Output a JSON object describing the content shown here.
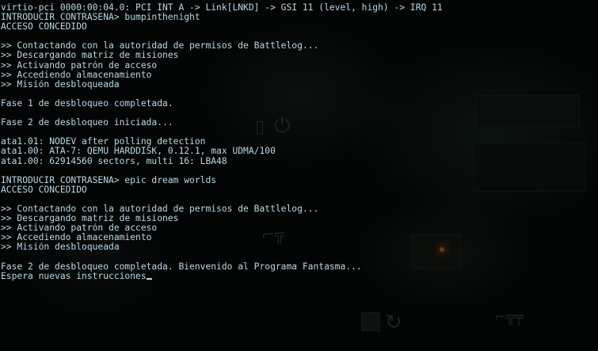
{
  "terminal": {
    "lines": [
      "virtio-pci 0000:00:04.0: PCI INT A -> Link[LNKD] -> GSI 11 (level, high) -> IRQ 11",
      "INTRODUCIR CONTRASEÑA> bumpinthenight",
      "ACCESO CONCEDIDO",
      "",
      ">> Contactando con la autoridad de permisos de Battlelog...",
      ">> Descargando matriz de misiones",
      ">> Activando patrón de acceso",
      ">> Accediendo almacenamiento",
      ">> Misión desbloqueada",
      "",
      "Fase 1 de desbloqueo completada.",
      "",
      "Fase 2 de desbloqueo iniciada...",
      "",
      "ata1.01: NODEV after polling detection",
      "ata1.00: ATA-7: QEMU HARDDISK, 0.12.1, max UDMA/100",
      "ata1.00: 62914560 sectors, multi 16: LBA48",
      "",
      "INTRODUCIR CONTRASEÑA> epic dream worlds",
      "ACCESO CONCEDIDO",
      "",
      ">> Contactando con la autoridad de permisos de Battlelog...",
      ">> Descargando matriz de misiones",
      ">> Activando patrón de acceso",
      ">> Accediendo almacenamiento",
      ">> Misión desbloqueada",
      "",
      "Fase 2 de desbloqueo completada. Bienvenido al Programa Fantasma...",
      "Espera nuevas instrucciones"
    ]
  },
  "colors": {
    "text": "#b9d8e6",
    "background": "#030504"
  }
}
